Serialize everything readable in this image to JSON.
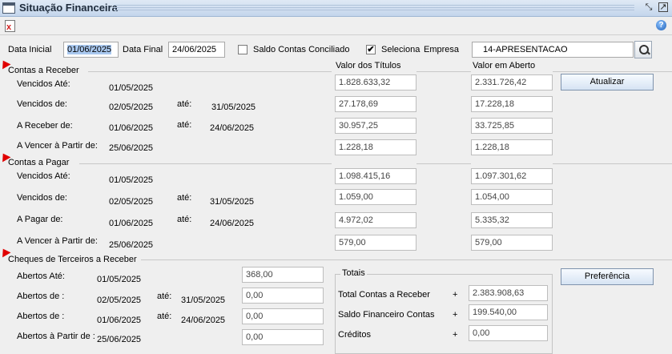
{
  "window": {
    "title": "Situação Financeira"
  },
  "filters": {
    "data_inicial_label": "Data Inicial",
    "data_inicial_value": "01/06/2025",
    "data_final_label": "Data Final",
    "data_final_value": "24/06/2025",
    "saldo_conciliado_label": "Saldo Contas Conciliado",
    "saldo_conciliado_checked": "",
    "seleciona_label": "Seleciona",
    "seleciona_checked": "✔",
    "empresa_label": "Empresa",
    "empresa_value": "14-APRESENTACAO"
  },
  "columns": {
    "valor_titulos": "Valor dos Títulos",
    "valor_aberto": "Valor em Aberto"
  },
  "buttons": {
    "atualizar": "Atualizar",
    "preferencia": "Preferência"
  },
  "receber": {
    "title": "Contas a Receber",
    "rows": [
      {
        "label": "Vencidos Até:",
        "d1": "01/05/2025",
        "ate": "",
        "d2": "",
        "titulos": "1.828.633,32",
        "aberto": "2.331.726,42"
      },
      {
        "label": "Vencidos de:",
        "d1": "02/05/2025",
        "ate": "até:",
        "d2": "31/05/2025",
        "titulos": "27.178,69",
        "aberto": "17.228,18"
      },
      {
        "label": "A Receber de:",
        "d1": "01/06/2025",
        "ate": "até:",
        "d2": "24/06/2025",
        "titulos": "30.957,25",
        "aberto": "33.725,85"
      },
      {
        "label": "A Vencer à Partir de:",
        "d1": "25/06/2025",
        "ate": "",
        "d2": "",
        "titulos": "1.228,18",
        "aberto": "1.228,18"
      }
    ]
  },
  "pagar": {
    "title": "Contas a Pagar",
    "rows": [
      {
        "label": "Vencidos Até:",
        "d1": "01/05/2025",
        "ate": "",
        "d2": "",
        "titulos": "1.098.415,16",
        "aberto": "1.097.301,62"
      },
      {
        "label": "Vencidos de:",
        "d1": "02/05/2025",
        "ate": "até:",
        "d2": "31/05/2025",
        "titulos": "1.059,00",
        "aberto": "1.054,00"
      },
      {
        "label": "A Pagar de:",
        "d1": "01/06/2025",
        "ate": "até:",
        "d2": "24/06/2025",
        "titulos": "4.972,02",
        "aberto": "5.335,32"
      },
      {
        "label": "A Vencer à Partir de:",
        "d1": "25/06/2025",
        "ate": "",
        "d2": "",
        "titulos": "579,00",
        "aberto": "579,00"
      }
    ]
  },
  "cheques": {
    "title": "Cheques de Terceiros a Receber",
    "rows": [
      {
        "label": "Abertos Até:",
        "d1": "01/05/2025",
        "ate": "",
        "d2": "",
        "valor": "368,00"
      },
      {
        "label": "Abertos de :",
        "d1": "02/05/2025",
        "ate": "até:",
        "d2": "31/05/2025",
        "valor": "0,00"
      },
      {
        "label": "Abertos de :",
        "d1": "01/06/2025",
        "ate": "até:",
        "d2": "24/06/2025",
        "valor": "0,00"
      },
      {
        "label": "Abertos à Partir de :",
        "d1": "25/06/2025",
        "ate": "",
        "d2": "",
        "valor": "0,00"
      }
    ]
  },
  "totais": {
    "title": "Totais",
    "rows": [
      {
        "label": "Total Contas a Receber",
        "sign": "+",
        "valor": "2.383.908,63"
      },
      {
        "label": "Saldo Financeiro Contas",
        "sign": "+",
        "valor": "199.540,00"
      },
      {
        "label": "Créditos",
        "sign": "+",
        "valor": "0,00"
      }
    ]
  },
  "icons": {
    "close_doc": "close-document-icon",
    "help": "help-icon",
    "search": "search-icon",
    "marker": "red-triangle-marker-icon"
  }
}
